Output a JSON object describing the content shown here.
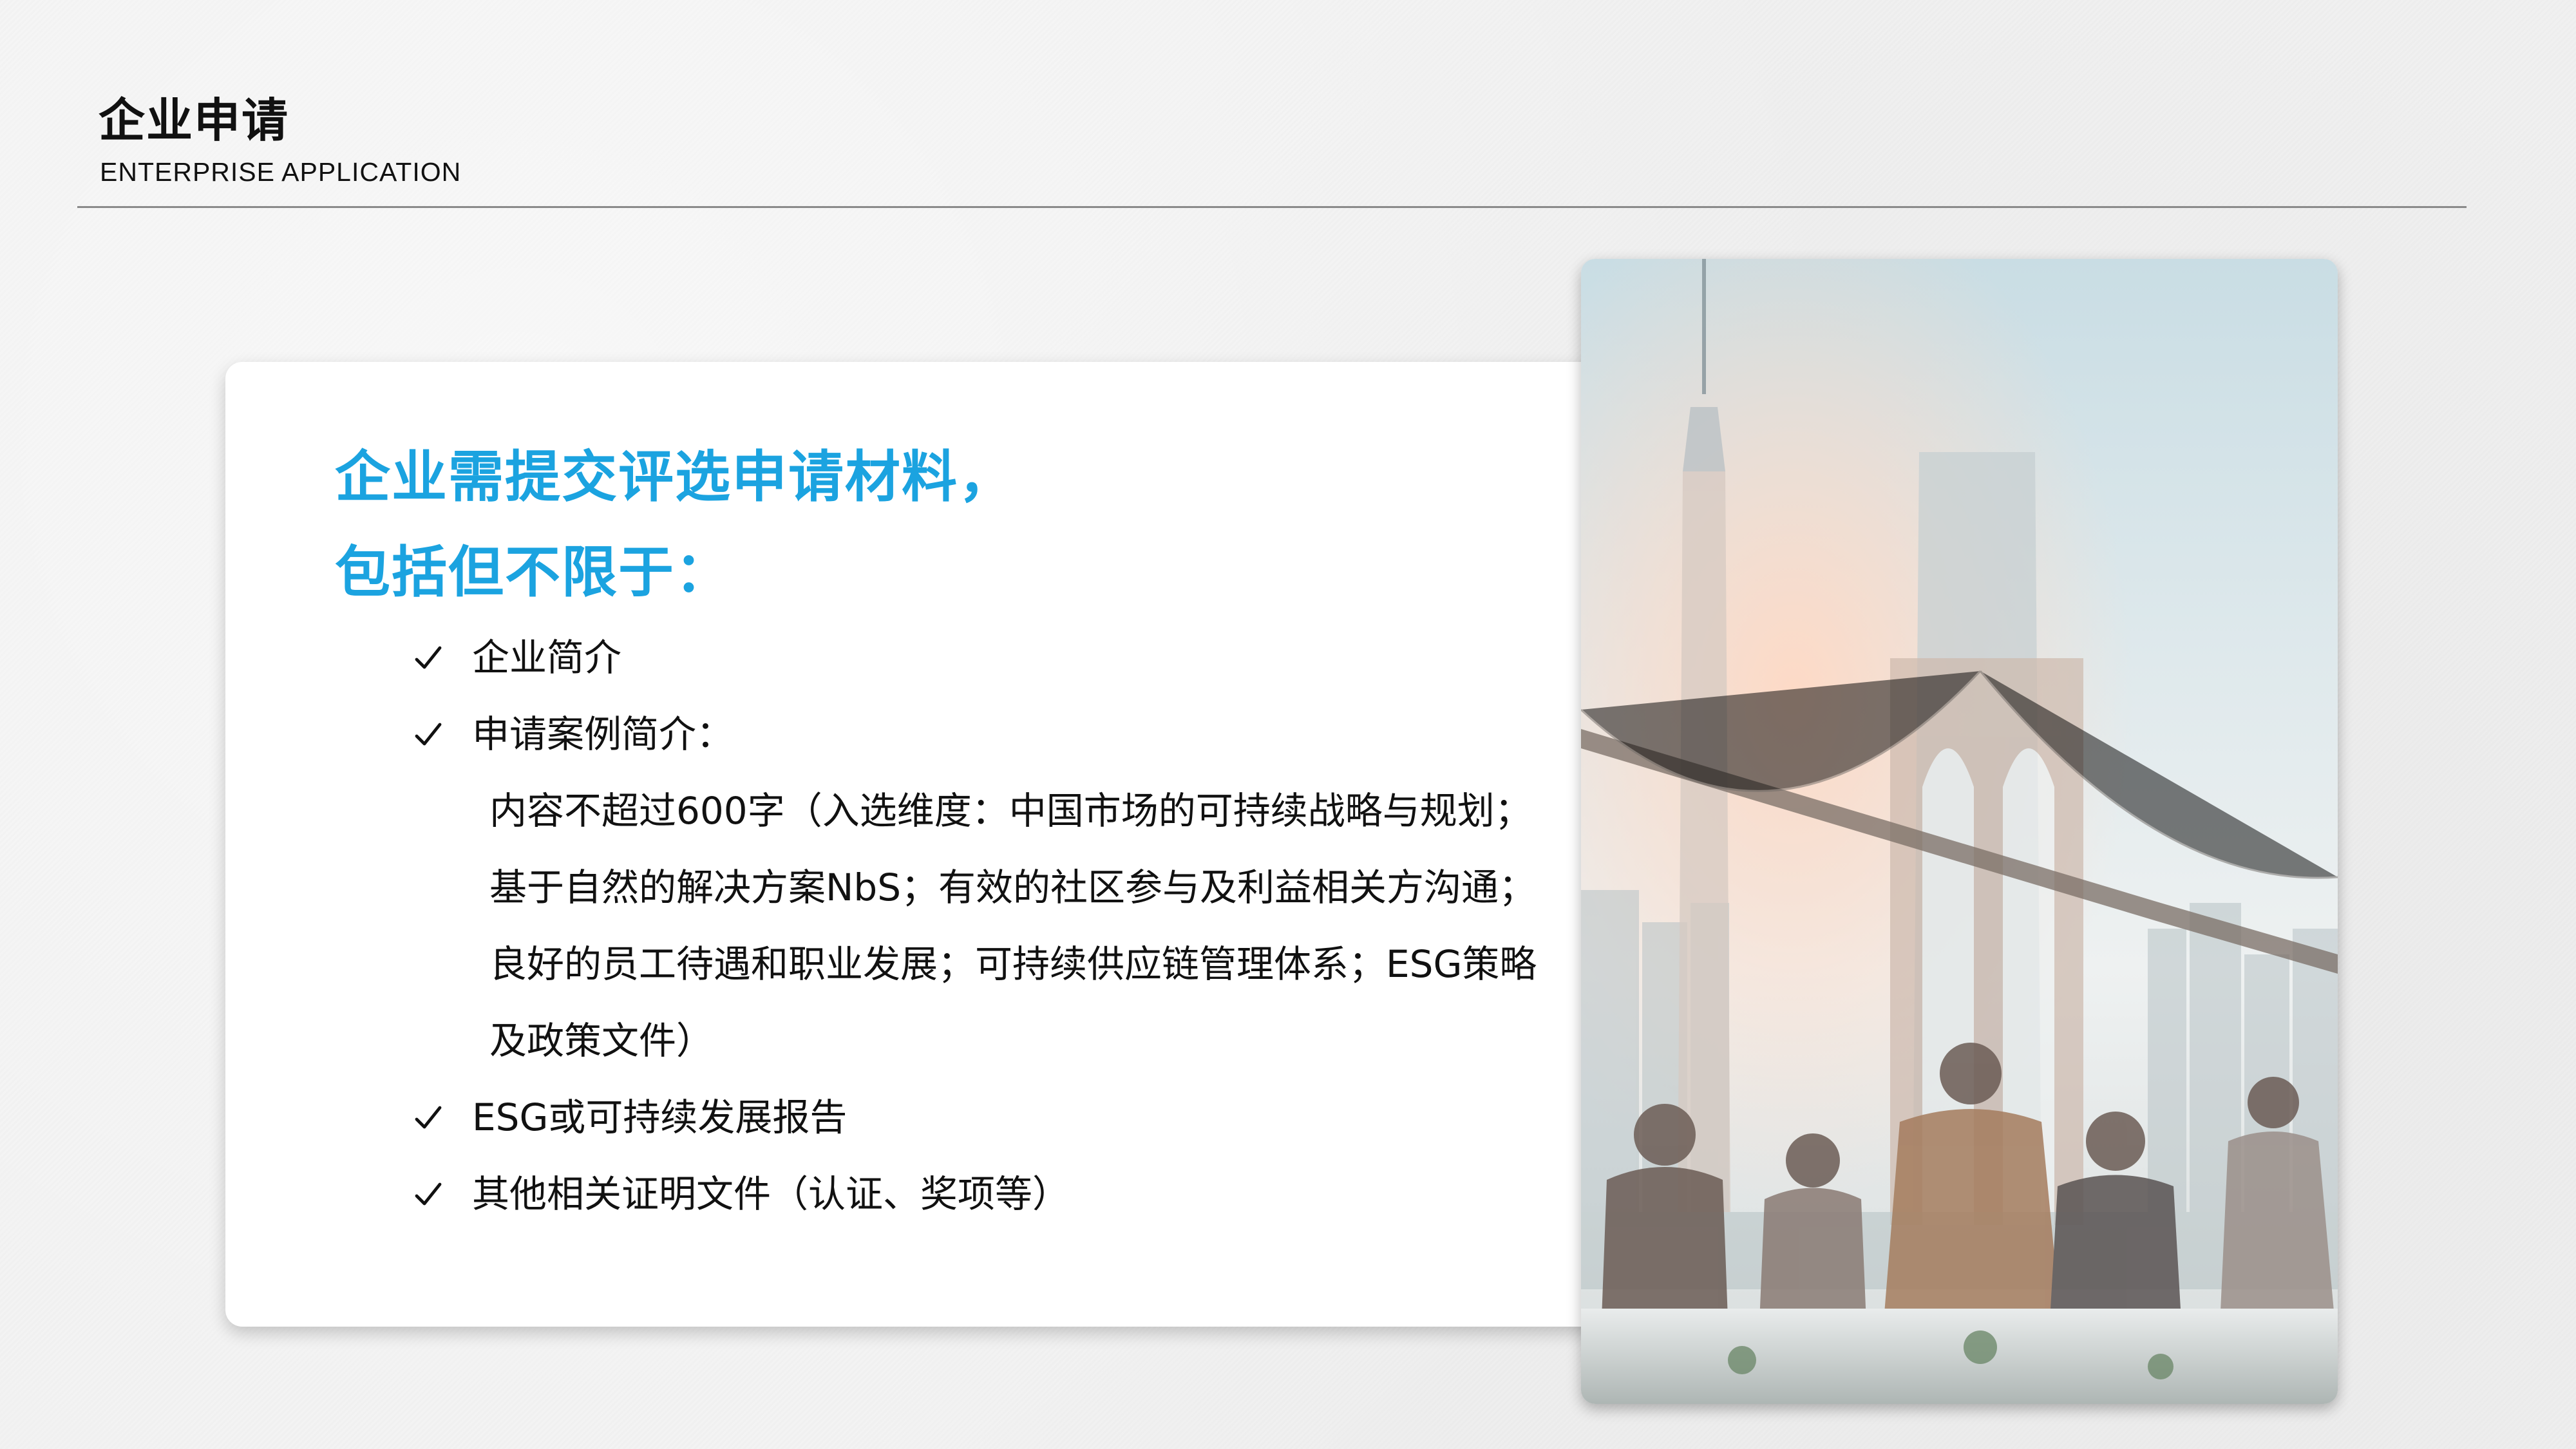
{
  "header": {
    "title": "企业申请",
    "subtitle": "ENTERPRISE APPLICATION"
  },
  "card": {
    "headline_line1": "企业需提交评选申请材料，",
    "headline_line2": "包括但不限于：",
    "items": [
      {
        "label": "企业简介"
      },
      {
        "label": "申请案例简介："
      },
      {
        "label": "ESG或可持续发展报告"
      },
      {
        "label": "其他相关证明文件（认证、奖项等）"
      }
    ],
    "detail": "内容不超过600字（入选维度：中国市场的可持续战略与规划；基于自然的解决方案NbS；有效的社区参与及利益相关方沟通；良好的员工待遇和职业发展；可持续供应链管理体系；ESG策略及政策文件）"
  },
  "colors": {
    "accent": "#1ba3e0",
    "text": "#111111",
    "divider": "#8a8a8a",
    "card": "#ffffff"
  },
  "icons": {
    "bullet": "check-icon"
  }
}
